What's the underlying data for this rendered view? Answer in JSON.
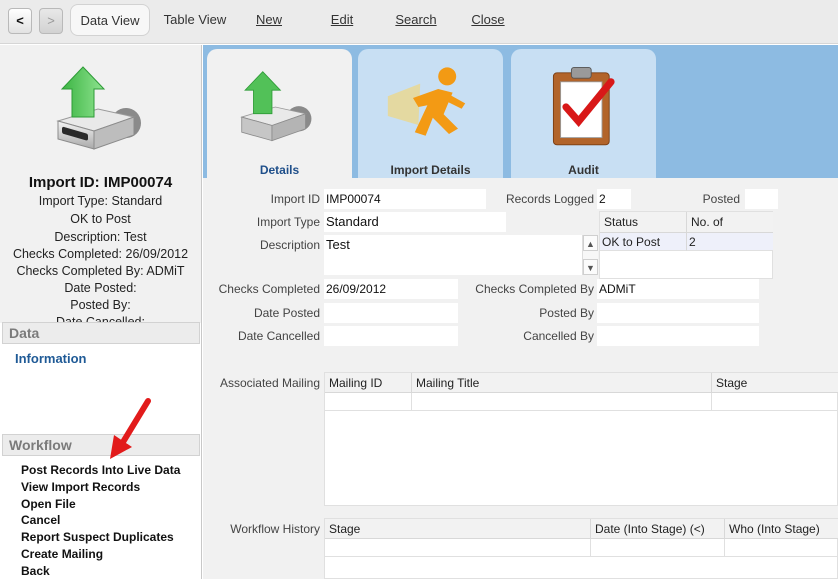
{
  "toolbar": {
    "back_label": "<",
    "forward_label": ">",
    "items": [
      "Data View",
      "Table View",
      "New",
      "Edit",
      "Search",
      "Close"
    ]
  },
  "summary": {
    "title": "Import ID: IMP00074",
    "lines": [
      "Import Type: Standard",
      "OK to Post",
      "Description: Test",
      "Checks Completed: 26/09/2012",
      "Checks Completed By: ADMiT",
      "Date Posted:",
      "Posted By:",
      "Date Cancelled:"
    ]
  },
  "sidebar": {
    "data_header": "Data",
    "information_link": "Information",
    "workflow_header": "Workflow",
    "workflow_items": [
      "Post Records Into Live Data",
      "View Import Records",
      "Open File",
      "Cancel",
      "Report Suspect Duplicates",
      "Create Mailing",
      "Back"
    ]
  },
  "tabs": [
    "Details",
    "Import Details",
    "Audit"
  ],
  "form": {
    "import_id_label": "Import ID",
    "import_id": "IMP00074",
    "records_logged_label": "Records Logged",
    "records_logged": "2",
    "posted_label": "Posted",
    "posted": "",
    "import_type_label": "Import Type",
    "import_type": "Standard",
    "description_label": "Description",
    "description": "Test",
    "checks_completed_label": "Checks Completed",
    "checks_completed": "26/09/2012",
    "checks_completed_by_label": "Checks Completed By",
    "checks_completed_by": "ADMiT",
    "date_posted_label": "Date Posted",
    "date_posted": "",
    "posted_by_label": "Posted By",
    "posted_by": "",
    "date_cancelled_label": "Date Cancelled",
    "date_cancelled": "",
    "cancelled_by_label": "Cancelled By",
    "cancelled_by": ""
  },
  "status_table": {
    "headers": [
      "Status",
      "No. of"
    ],
    "rows": [
      [
        "OK to Post",
        "2"
      ]
    ]
  },
  "associated_mailing": {
    "label": "Associated Mailing",
    "headers": [
      "Mailing ID",
      "Mailing Title",
      "Stage"
    ]
  },
  "workflow_history": {
    "label": "Workflow History",
    "headers": [
      "Stage",
      "Date (Into Stage) (<)",
      "Who (Into Stage)"
    ]
  },
  "colors": {
    "tab_strip": "#8dbbe2",
    "link_blue": "#1f5a96",
    "arrow_red": "#e21b1b"
  }
}
